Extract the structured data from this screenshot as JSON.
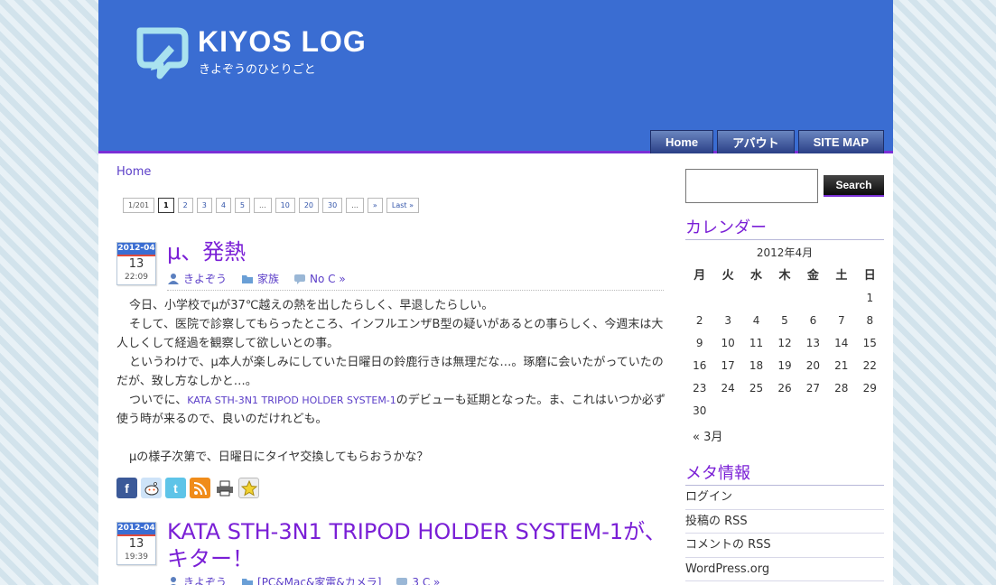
{
  "header": {
    "title": "KIYOS LOG",
    "tagline": "きよぞうのひとりごと",
    "nav": [
      "Home",
      "アバウト",
      "SITE MAP"
    ]
  },
  "breadcrumb": "Home",
  "pagination": {
    "info": "1/201",
    "items": [
      "1",
      "2",
      "3",
      "4",
      "5",
      "...",
      "10",
      "20",
      "30",
      "...",
      "»",
      "Last »"
    ],
    "current": "1"
  },
  "posts": [
    {
      "date_ym": "2012-04",
      "date_day": "13",
      "date_time": "22:09",
      "title": "μ、発熱",
      "author": "きよぞう",
      "category": "家族",
      "comments": "No C »",
      "body": {
        "p1": "今日、小学校でμが37℃越えの熱を出したらしく、早退したらしい。",
        "p2": "そして、医院で診察してもらったところ、インフルエンザB型の疑いがあるとの事らしく、今週末は大人しくして経過を観察して欲しいとの事。",
        "p3": "というわけで、μ本人が楽しみにしていた日曜日の鈴鹿行きは無理だな…。琢磨に会いたがっていたのだが、致し方なしかと…。",
        "p4_before": "ついでに、",
        "p4_link": "KATA STH-3N1 TRIPOD HOLDER SYSTEM-1",
        "p4_after": "のデビューも延期となった。ま、これはいつか必ず使う時が来るので、良いのだけれども。",
        "p5": "μの様子次第で、日曜日にタイヤ交換してもらおうかな？"
      }
    },
    {
      "date_ym": "2012-04",
      "date_day": "13",
      "date_time": "19:39",
      "title": "KATA STH-3N1 TRIPOD HOLDER SYSTEM-1が、キター！",
      "author": "きよぞう",
      "category": "[PC&Mac&家電&カメラ]",
      "comments": "3 C »"
    }
  ],
  "sidebar": {
    "search_button": "Search",
    "search_value": "",
    "calendar_title": "カレンダー",
    "calendar_caption": "2012年4月",
    "weekdays": [
      "月",
      "火",
      "水",
      "木",
      "金",
      "土",
      "日"
    ],
    "weeks": [
      [
        "",
        "",
        "",
        "",
        "",
        "",
        "1"
      ],
      [
        "2",
        "3",
        "4",
        "5",
        "6",
        "7",
        "8"
      ],
      [
        "9",
        "10",
        "11",
        "12",
        "13",
        "14",
        "15"
      ],
      [
        "16",
        "17",
        "18",
        "19",
        "20",
        "21",
        "22"
      ],
      [
        "23",
        "24",
        "25",
        "26",
        "27",
        "28",
        "29"
      ],
      [
        "30",
        "",
        "",
        "",
        "",
        "",
        ""
      ]
    ],
    "prev_month": "« 3月",
    "meta_title": "メタ情報",
    "meta_items": [
      "ログイン",
      "投稿の RSS",
      "コメントの RSS",
      "WordPress.org"
    ]
  },
  "colors": {
    "header_bg": "#3a6dd2",
    "accent_purple": "#7a1fd6",
    "link": "#5b3ec8"
  }
}
